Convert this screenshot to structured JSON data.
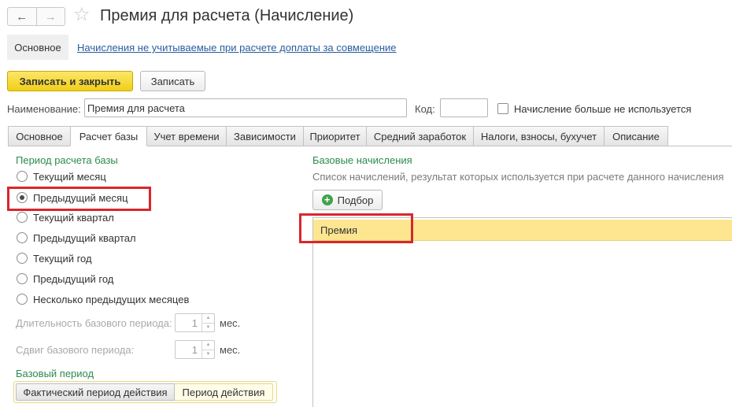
{
  "header": {
    "title": "Премия для расчета (Начисление)",
    "back_icon": "←",
    "forward_icon": "→",
    "star_icon": "☆"
  },
  "nav_panel": {
    "main_label": "Основное",
    "link_label": "Начисления не учитываемые при расчете доплаты за совмещение"
  },
  "commands": {
    "save_close_label": "Записать и закрыть",
    "save_label": "Записать"
  },
  "fields": {
    "name_label": "Наименование:",
    "name_value": "Премия для расчета",
    "code_label": "Код:",
    "code_value": "",
    "not_used_label": "Начисление больше не используется",
    "not_used_checked": false
  },
  "tabs": [
    {
      "label": "Основное",
      "active": false
    },
    {
      "label": "Расчет базы",
      "active": true
    },
    {
      "label": "Учет времени",
      "active": false
    },
    {
      "label": "Зависимости",
      "active": false
    },
    {
      "label": "Приоритет",
      "active": false
    },
    {
      "label": "Средний заработок",
      "active": false
    },
    {
      "label": "Налоги, взносы, бухучет",
      "active": false
    },
    {
      "label": "Описание",
      "active": false
    }
  ],
  "base_period": {
    "title": "Период расчета базы",
    "options": [
      {
        "label": "Текущий месяц",
        "selected": false
      },
      {
        "label": "Предыдущий месяц",
        "selected": true
      },
      {
        "label": "Текущий квартал",
        "selected": false
      },
      {
        "label": "Предыдущий квартал",
        "selected": false
      },
      {
        "label": "Текущий год",
        "selected": false
      },
      {
        "label": "Предыдущий год",
        "selected": false
      },
      {
        "label": "Несколько предыдущих месяцев",
        "selected": false
      }
    ],
    "duration_label": "Длительность базового периода:",
    "duration_value": "1",
    "shift_label": "Сдвиг базового периода:",
    "shift_value": "1",
    "unit_label": "мес.",
    "spin_up": "▲",
    "spin_down": "▼"
  },
  "base_period_kind": {
    "title": "Базовый период",
    "actual_label": "Фактический период действия",
    "action_label": "Период действия",
    "selected": "Период действия"
  },
  "base_accruals": {
    "title": "Базовые начисления",
    "description": "Список начислений, результат которых используется при расчете данного начисления",
    "pick_label": "Подбор",
    "rows": [
      "Премия"
    ]
  },
  "colors": {
    "accent_yellow": "#f2cf16",
    "group_title_green": "#2c8a4e",
    "highlight_red": "#d9262c",
    "selected_row": "#fde68f",
    "link_blue": "#2a5d9f"
  }
}
